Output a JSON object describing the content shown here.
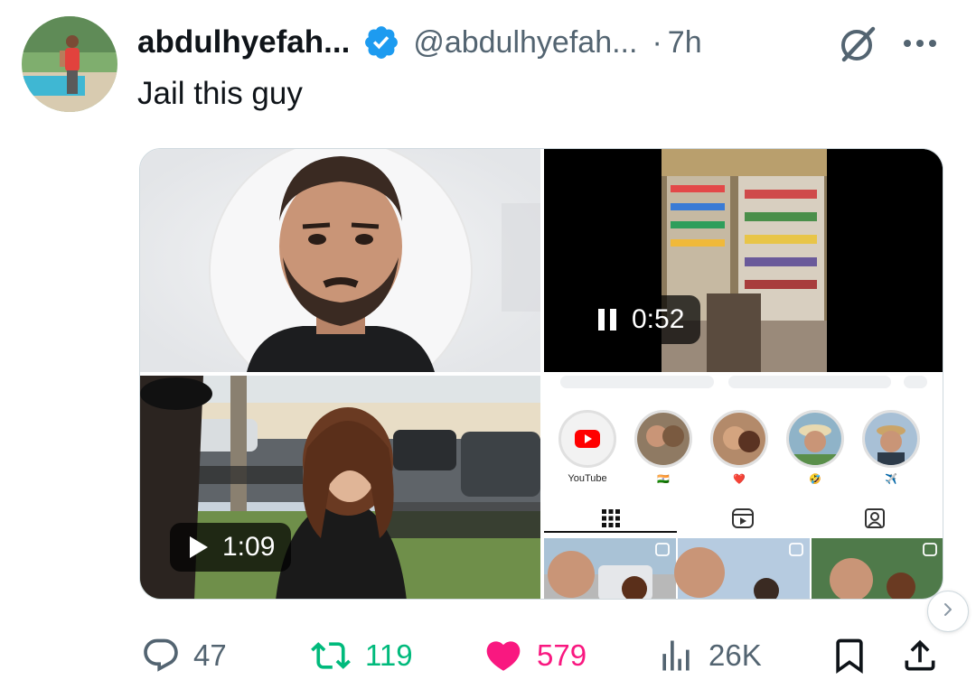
{
  "tweet": {
    "author": {
      "display_name": "abdulhyefah...",
      "handle": "@abdulhyefah...",
      "verified": true,
      "avatar_icon": "profile-photo"
    },
    "separator": "·",
    "time": "7h",
    "text": "Jail this guy"
  },
  "media": {
    "tiles": [
      {
        "kind": "image",
        "icon": "portrait-photo"
      },
      {
        "kind": "video",
        "state": "playing",
        "duration": "0:52",
        "icon": "pause-icon"
      },
      {
        "kind": "video",
        "state": "paused",
        "duration": "1:09",
        "icon": "play-icon"
      },
      {
        "kind": "image",
        "icon": "instagram-profile-screenshot"
      }
    ],
    "instagram_screenshot": {
      "stories": [
        {
          "label": "YouTube",
          "icon": "youtube-icon"
        },
        {
          "label": "🇮🇳"
        },
        {
          "label": "❤️"
        },
        {
          "label": "🤣"
        },
        {
          "label": "✈️"
        }
      ]
    }
  },
  "actions": {
    "replies": "47",
    "reposts": "119",
    "likes": "579",
    "views": "26K"
  },
  "colors": {
    "verified_blue": "#1d9bf0",
    "text_primary": "#0f1419",
    "text_secondary": "#536471",
    "repost_green": "#00ba7c",
    "like_pink": "#f91880"
  }
}
